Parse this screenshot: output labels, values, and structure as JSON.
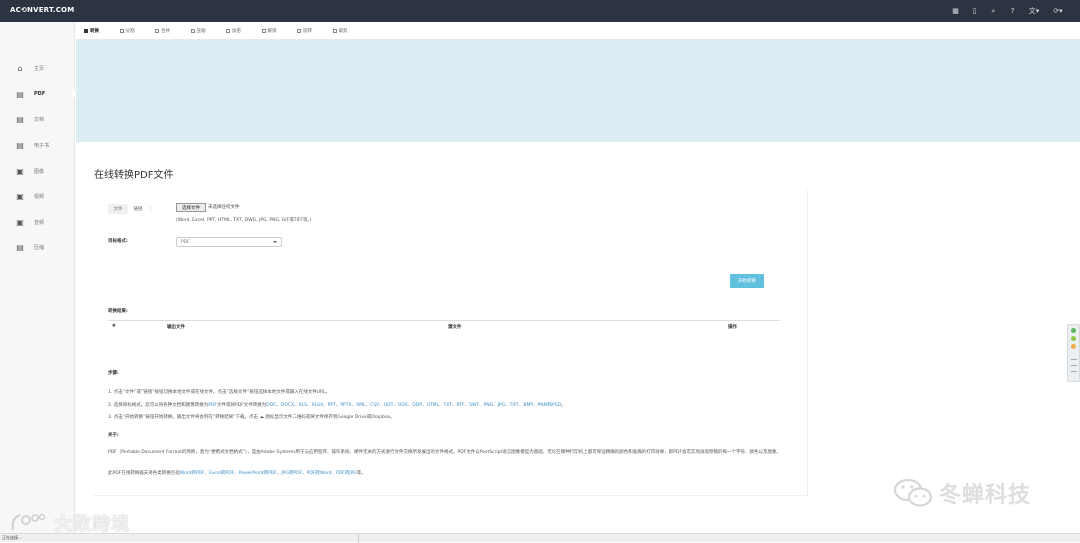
{
  "app": {
    "logo": "AC⟲NVERT.COM"
  },
  "topbar": {
    "icons": [
      "grid-icon",
      "bookmark-icon",
      "search-icon",
      "help-icon",
      "language-icon",
      "refresh-icon"
    ]
  },
  "sidebar": {
    "items": [
      {
        "label": "主页",
        "icon": "home-icon"
      },
      {
        "label": "PDF",
        "icon": "pdf-icon",
        "active": true
      },
      {
        "label": "文档",
        "icon": "document-icon"
      },
      {
        "label": "电子书",
        "icon": "ebook-icon"
      },
      {
        "label": "图像",
        "icon": "image-icon"
      },
      {
        "label": "视频",
        "icon": "video-icon"
      },
      {
        "label": "音频",
        "icon": "audio-icon"
      },
      {
        "label": "压缩",
        "icon": "archive-icon"
      }
    ]
  },
  "tabs": [
    {
      "label": "转换",
      "active": true
    },
    {
      "label": "分割"
    },
    {
      "label": "合并"
    },
    {
      "label": "压缩"
    },
    {
      "label": "加密"
    },
    {
      "label": "解锁"
    },
    {
      "label": "旋转"
    },
    {
      "label": "裁剪"
    }
  ],
  "main": {
    "title": "在线转换PDF文件",
    "source_tabs": {
      "file": "文件",
      "link": "链接",
      "colon": ":"
    },
    "choose_file": "选择文件",
    "no_file": "未选择任何文件",
    "formats_hint": "(Word, Excel, PPT, HTML, TXT, DWG, JPG, PNG, GIF或TIFF等。)",
    "target_label": "目标格式:",
    "target_value": "PDF",
    "start_button": "开始转换",
    "result_title": "转换结果:",
    "result_columns": [
      "#",
      "输出文件",
      "源文件",
      "操作"
    ],
    "steps_title": "步骤:",
    "step1": "1. 点击“文件”或“链接”按钮切换本地文件或在线文件。点击“选择文件”按钮选择本地文件或输入在线文件URL。",
    "step2_prefix": "2. 选择目标格式。您可以将各种文档和图像转换为",
    "step2_link1": "PDF",
    "step2_mid": "文件或将PDF文件转换为",
    "step2_formats": "DOC、DOCX、XLS、XLSX、PPT、PPTX、XML、CSV、ODT、ODS、ODP、HTML、TXT、RTF、SWF、PNG、JPG、TIFF、BMP、PNM和PSD",
    "step2_suffix": "。",
    "step3": "3. 点击“开始转换”按钮开始转换。输出文件将会列在“转换结果”下载。点击 ☁ 图标显示文件二维码或将文件保存到Google Drive或Dropbox。",
    "about_title": "关于:",
    "about_text": "PDF（Portable Document Format的简称，意为“便携式文档格式”），是由Adobe Systems用于与应用程序、操作系统、硬件无关的方式进行文件交换所发展出的文件格式。PDF文件以PostScript语言图象模型为基础，无论在哪种打印机上都可保证精确的颜色和准确的打印效果，即PDF会忠实地再现原稿的每一个字符、颜色以及图象。",
    "more_prefix": "此PDF在线转换器支持各类转换包括",
    "more_links": "Word转PDF、Excel转PDF、PowerPoint转PDF、JPG转PDF、PDF转Word、PDF转JPG",
    "more_suffix": "等。"
  },
  "watermarks": {
    "right": "冬蝉科技",
    "left": "大数跨境"
  },
  "status": {
    "text": "正在连接..."
  },
  "colors": {
    "topbar": "#2b3440",
    "banner": "#dcedf3",
    "accent": "#61c0de",
    "link": "#3d8ec4"
  }
}
